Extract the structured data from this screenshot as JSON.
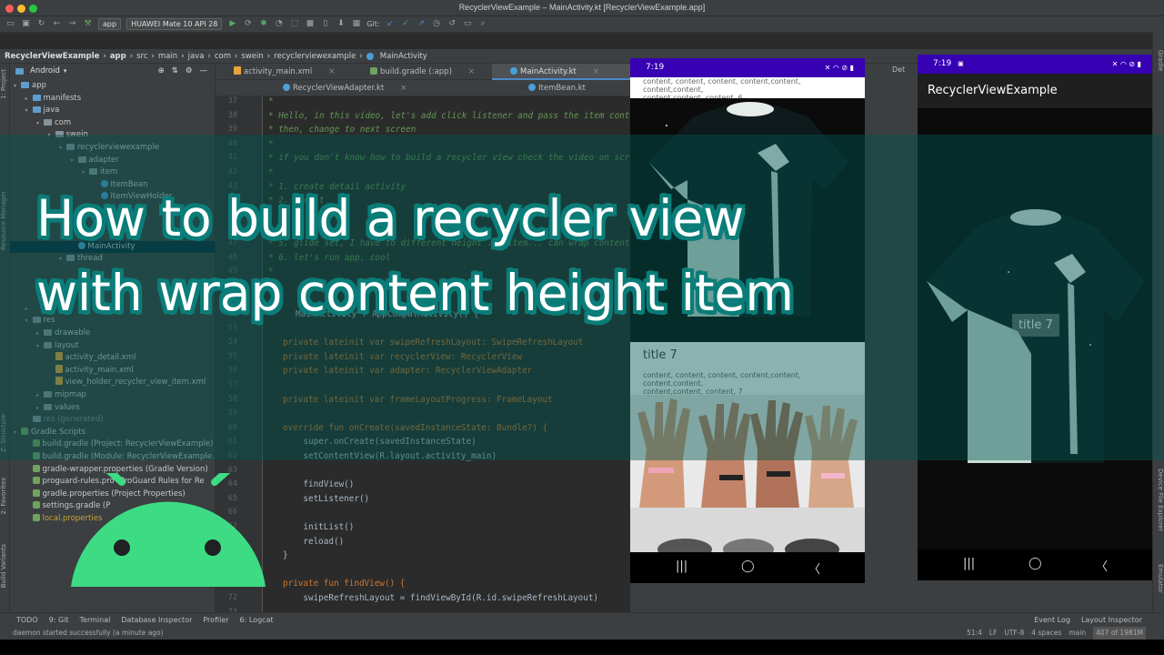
{
  "window": {
    "title": "RecyclerViewExample – MainActivity.kt [RecyclerViewExample.app]"
  },
  "toolbar": {
    "module": "app",
    "device": "HUAWEI Mate 10 API 28",
    "git_label": "Git:"
  },
  "breadcrumbs": [
    "RecyclerViewExample",
    "app",
    "src",
    "main",
    "java",
    "com",
    "swein",
    "recyclerviewexample",
    "MainActivity"
  ],
  "project_panel": {
    "view_label": "Android",
    "side_labels": {
      "project": "1: Project",
      "resource_manager": "Resource Manager",
      "structure": "Z: Structure",
      "favorites": "2: Favorites",
      "build_variants": "Build Variants"
    },
    "tree": [
      {
        "label": "app",
        "indent": 0,
        "kind": "folder-blue",
        "tri": "▾"
      },
      {
        "label": "manifests",
        "indent": 1,
        "kind": "folder-blue",
        "tri": "▸"
      },
      {
        "label": "java",
        "indent": 1,
        "kind": "folder-blue",
        "tri": "▾"
      },
      {
        "label": "com",
        "indent": 2,
        "kind": "folder",
        "tri": "▾"
      },
      {
        "label": "swein",
        "indent": 3,
        "kind": "folder",
        "tri": "▾"
      },
      {
        "label": "recyclerviewexample",
        "indent": 4,
        "kind": "folder",
        "tri": "▾"
      },
      {
        "label": "adapter",
        "indent": 5,
        "kind": "folder",
        "tri": "▾"
      },
      {
        "label": "item",
        "indent": 6,
        "kind": "folder",
        "tri": "▾"
      },
      {
        "label": "ItemBean",
        "indent": 7,
        "kind": "kt",
        "tri": ""
      },
      {
        "label": "ItemViewHolder",
        "indent": 7,
        "kind": "kt",
        "tri": ""
      },
      {
        "label": "a",
        "indent": 8,
        "kind": "none",
        "tri": ""
      },
      {
        "label": "",
        "indent": 8,
        "kind": "none",
        "tri": ""
      },
      {
        "label": "",
        "indent": 6,
        "kind": "none",
        "tri": ""
      },
      {
        "label": "MainActivity",
        "indent": 5,
        "kind": "kt",
        "tri": "",
        "selected": true
      },
      {
        "label": "thread",
        "indent": 4,
        "kind": "folder",
        "tri": "▾"
      },
      {
        "label": "",
        "indent": 5,
        "kind": "none",
        "tri": ""
      },
      {
        "label": "",
        "indent": 5,
        "kind": "none",
        "tri": ""
      },
      {
        "label": "",
        "indent": 1,
        "kind": "none",
        "tri": ""
      },
      {
        "label": "",
        "indent": 1,
        "kind": "none",
        "tri": "▸"
      },
      {
        "label": "res",
        "indent": 1,
        "kind": "folder",
        "tri": "▾"
      },
      {
        "label": "drawable",
        "indent": 2,
        "kind": "folder",
        "tri": "▸"
      },
      {
        "label": "layout",
        "indent": 2,
        "kind": "folder",
        "tri": "▾"
      },
      {
        "label": "activity_detail.xml",
        "indent": 3,
        "kind": "xml",
        "tri": ""
      },
      {
        "label": "activity_main.xml",
        "indent": 3,
        "kind": "xml",
        "tri": ""
      },
      {
        "label": "view_holder_recycler_view_item.xml",
        "indent": 3,
        "kind": "xml",
        "tri": ""
      },
      {
        "label": "mipmap",
        "indent": 2,
        "kind": "folder",
        "tri": "▸"
      },
      {
        "label": "values",
        "indent": 2,
        "kind": "folder",
        "tri": "▸"
      },
      {
        "label": "res (generated)",
        "indent": 1,
        "kind": "folder",
        "tri": "",
        "dim": true
      },
      {
        "label": "Gradle Scripts",
        "indent": 0,
        "kind": "grad",
        "tri": "▾"
      },
      {
        "label": "build.gradle (Project: RecyclerViewExample)",
        "indent": 1,
        "kind": "grad",
        "tri": ""
      },
      {
        "label": "build.gradle (Module: RecyclerViewExample.app)",
        "indent": 1,
        "kind": "grad",
        "tri": ""
      },
      {
        "label": "gradle-wrapper.properties (Gradle Version)",
        "indent": 1,
        "kind": "grad",
        "tri": ""
      },
      {
        "label": "proguard-rules.pro (ProGuard Rules for Re",
        "indent": 1,
        "kind": "grad",
        "tri": ""
      },
      {
        "label": "gradle.properties (Project Properties)",
        "indent": 1,
        "kind": "grad",
        "tri": ""
      },
      {
        "label": "settings.gradle (P",
        "indent": 1,
        "kind": "grad",
        "tri": ""
      },
      {
        "label": "local.properties",
        "indent": 1,
        "kind": "grad",
        "tri": "",
        "warn": true
      }
    ]
  },
  "editor": {
    "tabs_row1": [
      "activity_main.xml",
      "build.gradle (:app)",
      "MainActivity.kt"
    ],
    "tabs_row2": [
      "RecyclerViewAdapter.kt",
      "ItemBean.kt"
    ],
    "line_numbers": [
      "37",
      "38",
      "39",
      "40",
      "41",
      "42",
      "43",
      "44",
      "45",
      "46",
      "47",
      "48",
      "49",
      "50",
      "51",
      "52",
      "53",
      "54",
      "55",
      "56",
      "57",
      "58",
      "59",
      "60",
      "61",
      "62",
      "63",
      "64",
      "65",
      "66",
      "67",
      "68",
      "69",
      "70",
      "71",
      "72",
      "73"
    ],
    "lines": [
      "*",
      "* Hello, in this video, let's add click listener and pass the item content",
      "* then, change to next screen",
      "*",
      "* if you don't know how to build a recycler view check the video on screen",
      "*",
      "* 1. create detail activity",
      "* 2. add it",
      "* 3. ",
      "* 4. ",
      "* 5. glide set, I have to different height ... item... can wrap content",
      "* 6. let's run app, cool",
      "*",
      "",
      "",
      "",
      "",
      "private lateinit var swipeRefreshLayout: SwipeRefreshLayout",
      "private lateinit var recyclerView: RecyclerView",
      "private lateinit var adapter: RecyclerViewAdapter",
      "",
      "private lateinit var frameLayoutProgress: FrameLayout",
      "",
      "override fun onCreate(savedInstanceState: Bundle?) {",
      "    super.onCreate(savedInstanceState)",
      "    setContentView(R.layout.activity_main)",
      "",
      "    findView()",
      "    setListener()",
      "",
      "    initList()",
      "    reload()",
      "}",
      "",
      "private fun findView() {",
      "    swipeRefreshLayout = findViewById(R.id.swipeRefreshLayout)",
      ""
    ],
    "class_line": "MainActivity : AppCompatActivity() {"
  },
  "phone1": {
    "time": "7:19",
    "top_text_1": "content, content, content, content,content, content,content,",
    "top_text_2": "content,content, content, 6",
    "title": "title 7",
    "body_1": "content, content, content, content,content, content,content,",
    "body_2": "content,content, content, 7",
    "nav": [
      "|||",
      "◯",
      "〈"
    ]
  },
  "phone2": {
    "time": "7:19",
    "app_title": "RecyclerViewExample",
    "overlay_title": "title 7",
    "nav": [
      "|||",
      "◯",
      "〈"
    ]
  },
  "right_strip": {
    "gradle": "Gradle",
    "device_file_explorer": "Device File Explorer",
    "emulator": "Emulator",
    "detail_tab": "Det"
  },
  "bottom_tools": [
    "TODO",
    "9: Git",
    "Terminal",
    "Database Inspector",
    "Profiler",
    "6: Logcat"
  ],
  "bottom_right": [
    "Event Log",
    "Layout Inspector"
  ],
  "status": {
    "message": "daemon started successfully (a minute ago)",
    "position": "51:4",
    "line_sep": "LF",
    "encoding": "UTF-8",
    "indent": "4 spaces",
    "branch": "main",
    "memory": "407 of 1981M"
  },
  "headline": {
    "line1": "How to build a recycler view",
    "line2": "with wrap content height item"
  },
  "colors": {
    "android_green": "#3ddc84",
    "overlay": "#00544e",
    "accent": "#4a88c7"
  }
}
